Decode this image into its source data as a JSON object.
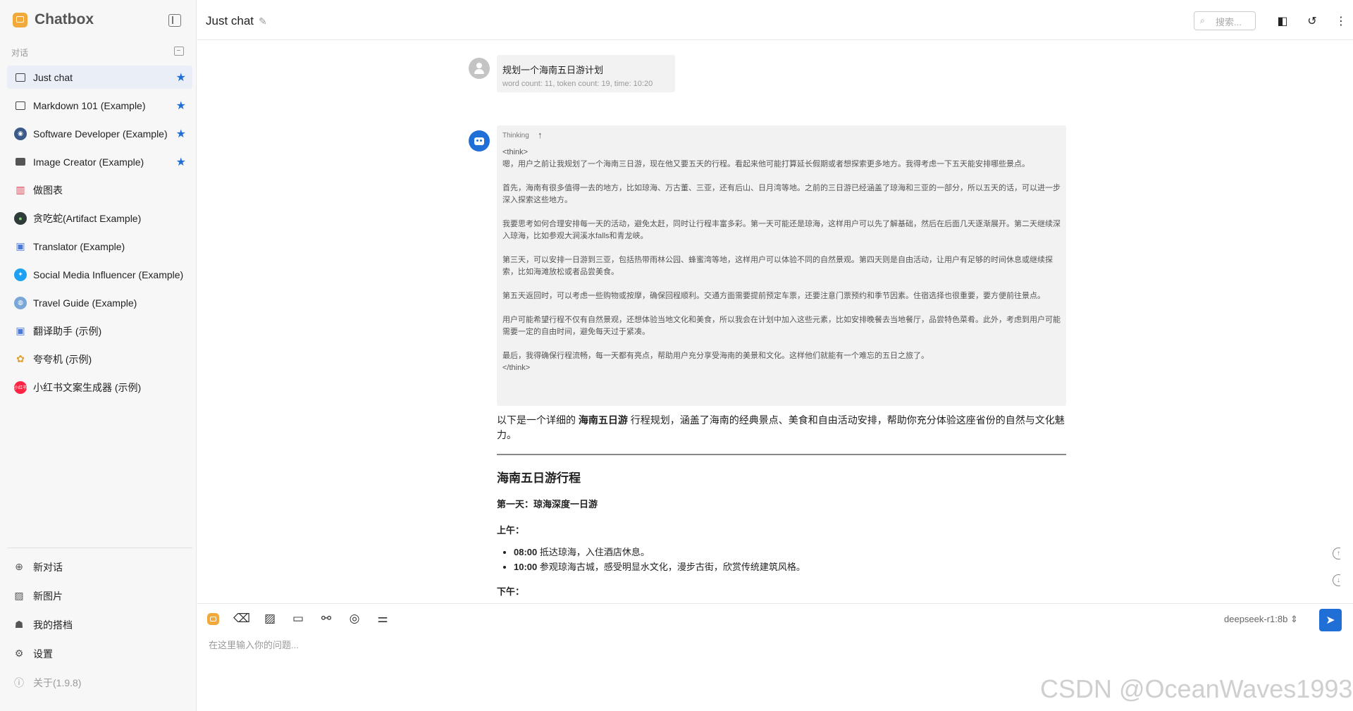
{
  "app": {
    "name": "Chatbox"
  },
  "sidebar": {
    "section_label": "对话",
    "conversations": [
      {
        "label": "Just chat",
        "icon": "chat-bubble-icon",
        "starred": true,
        "active": true
      },
      {
        "label": "Markdown 101 (Example)",
        "icon": "chat-bubble-icon",
        "starred": true
      },
      {
        "label": "Software Developer (Example)",
        "icon": "developer-avatar-icon",
        "starred": true
      },
      {
        "label": "Image Creator (Example)",
        "icon": "image-icon",
        "starred": true
      },
      {
        "label": "做图表",
        "icon": "chart-avatar-icon"
      },
      {
        "label": "贪吃蛇(Artifact Example)",
        "icon": "snake-avatar-icon"
      },
      {
        "label": "Translator (Example)",
        "icon": "translator-avatar-icon"
      },
      {
        "label": "Social Media Influencer (Example)",
        "icon": "twitter-avatar-icon"
      },
      {
        "label": "Travel Guide (Example)",
        "icon": "globe-avatar-icon"
      },
      {
        "label": "翻译助手 (示例)",
        "icon": "translator-avatar-icon"
      },
      {
        "label": "夸夸机 (示例)",
        "icon": "praise-avatar-icon"
      },
      {
        "label": "小红书文案生成器 (示例)",
        "icon": "xiaohongshu-avatar-icon"
      }
    ],
    "bottom": {
      "new_chat": "新对话",
      "new_image": "新图片",
      "my_partners": "我的搭档",
      "settings": "设置",
      "about": "关于(1.9.8)"
    }
  },
  "header": {
    "title": "Just chat",
    "search_placeholder": "搜索..."
  },
  "messages": {
    "user": {
      "text": "规划一个海南五日游计划",
      "meta": "word count: 11, token count: 19, time: 10:20"
    },
    "assistant": {
      "thinking_label": "Thinking",
      "think_open": "<think>",
      "think_paragraphs": [
        "嗯，用户之前让我规划了一个海南三日游，现在他又要五天的行程。看起来他可能打算延长假期或者想探索更多地方。我得考虑一下五天能安排哪些景点。",
        "首先，海南有很多值得一去的地方，比如琼海、万古董、三亚，还有后山、日月湾等地。之前的三日游已经涵盖了琼海和三亚的一部分，所以五天的话，可以进一步深入探索这些地方。",
        "我要思考如何合理安排每一天的活动，避免太赶，同时让行程丰富多彩。第一天可能还是琼海，这样用户可以先了解基础，然后在后面几天逐渐展开。第二天继续深入琼海，比如参观大涧溪水falls和青龙峡。",
        "第三天，可以安排一日游到三亚，包括热带雨林公园、蜂蜜湾等地，这样用户可以体验不同的自然景观。第四天则是自由活动，让用户有足够的时间休息或继续探索，比如海滩放松或者品尝美食。",
        "第五天返回时，可以考虑一些购物或按摩，确保回程顺利。交通方面需要提前预定车票，还要注意门票预约和季节因素。住宿选择也很重要，要方便前往景点。",
        "用户可能希望行程不仅有自然景观，还想体验当地文化和美食，所以我会在计划中加入这些元素，比如安排晚餐去当地餐厅，品尝特色菜肴。此外，考虑到用户可能需要一定的自由时间，避免每天过于紧凑。",
        "最后，我得确保行程流畅，每一天都有亮点，帮助用户充分享受海南的美景和文化。这样他们就能有一个难忘的五日之旅了。"
      ],
      "think_close": "</think>",
      "intro_before": "以下是一个详细的 ",
      "intro_bold": "海南五日游",
      "intro_after": " 行程规划，涵盖了海南的经典景点、美食和自由活动安排，帮助你充分体验这座省份的自然与文化魅力。",
      "heading": "海南五日游行程",
      "day1_title": "第一天：琼海深度一日游",
      "morning_label": "上午：",
      "morning_items": [
        {
          "time": "08:00",
          "text": " 抵达琼海，入住酒店休息。"
        },
        {
          "time": "10:00",
          "text": " 参观琼海古城，感受明显水文化，漫步古街，欣赏传统建筑风格。"
        }
      ],
      "afternoon_label": "下午："
    }
  },
  "input": {
    "placeholder": "在这里输入你的问题...",
    "model": "deepseek-r1:8b"
  },
  "watermark": "CSDN @OceanWaves1993",
  "colors": {
    "accent": "#1f6fd6",
    "brand": "#f2a93b",
    "sidebar_bg": "#f7f7f7",
    "active_bg": "#e9eef7"
  }
}
